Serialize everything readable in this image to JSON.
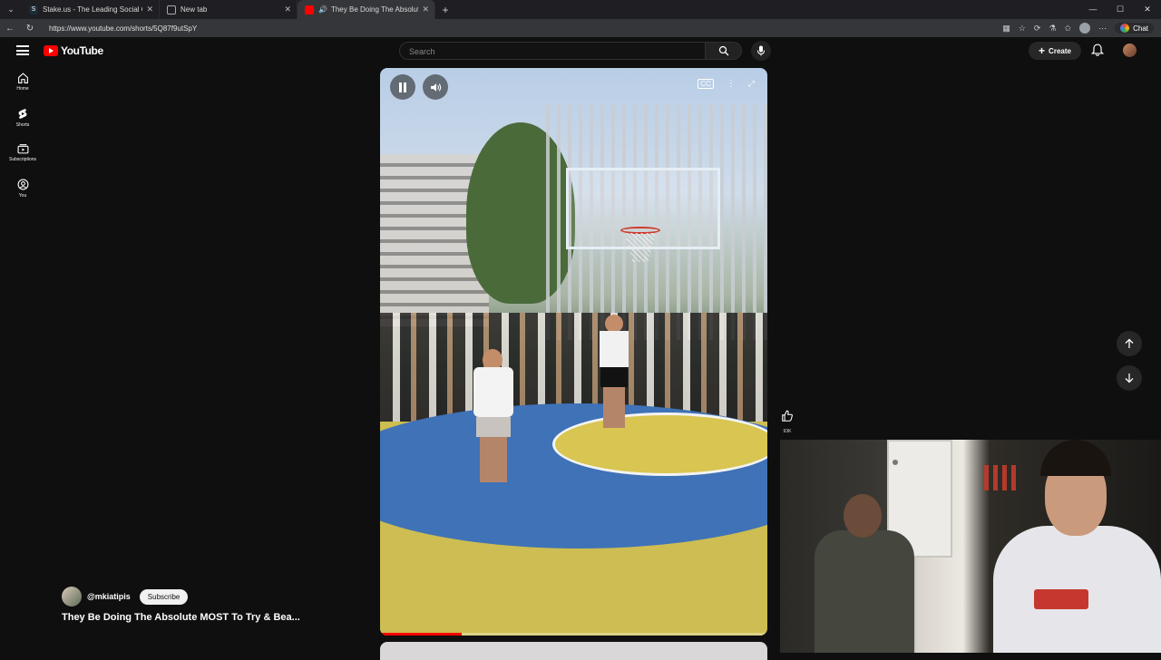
{
  "browser": {
    "tabs": [
      {
        "title": "Stake.us - The Leading Social Casino"
      },
      {
        "title": "New tab"
      },
      {
        "title": "They Be Doing The Absolute MOST To Try & Beat..."
      }
    ],
    "url": "https://www.youtube.com/shorts/5Q87f9utSpY",
    "chat_label": "Chat"
  },
  "youtube": {
    "logo_text": "YouTube",
    "search_placeholder": "Search",
    "create_label": "Create",
    "sidebar": [
      {
        "label": "Home",
        "icon": "home-icon"
      },
      {
        "label": "Shorts",
        "icon": "shorts-icon"
      },
      {
        "label": "Subscriptions",
        "icon": "subscriptions-icon"
      },
      {
        "label": "You",
        "icon": "you-icon"
      }
    ]
  },
  "short": {
    "channel": "@mkiatipis",
    "subscribe_label": "Subscribe",
    "title": "They Be Doing The Absolute MOST To Try & Bea...",
    "like_count": "93K",
    "progress": 0.21
  },
  "colors": {
    "accent": "#ff0000",
    "background": "#0f0f0f"
  }
}
